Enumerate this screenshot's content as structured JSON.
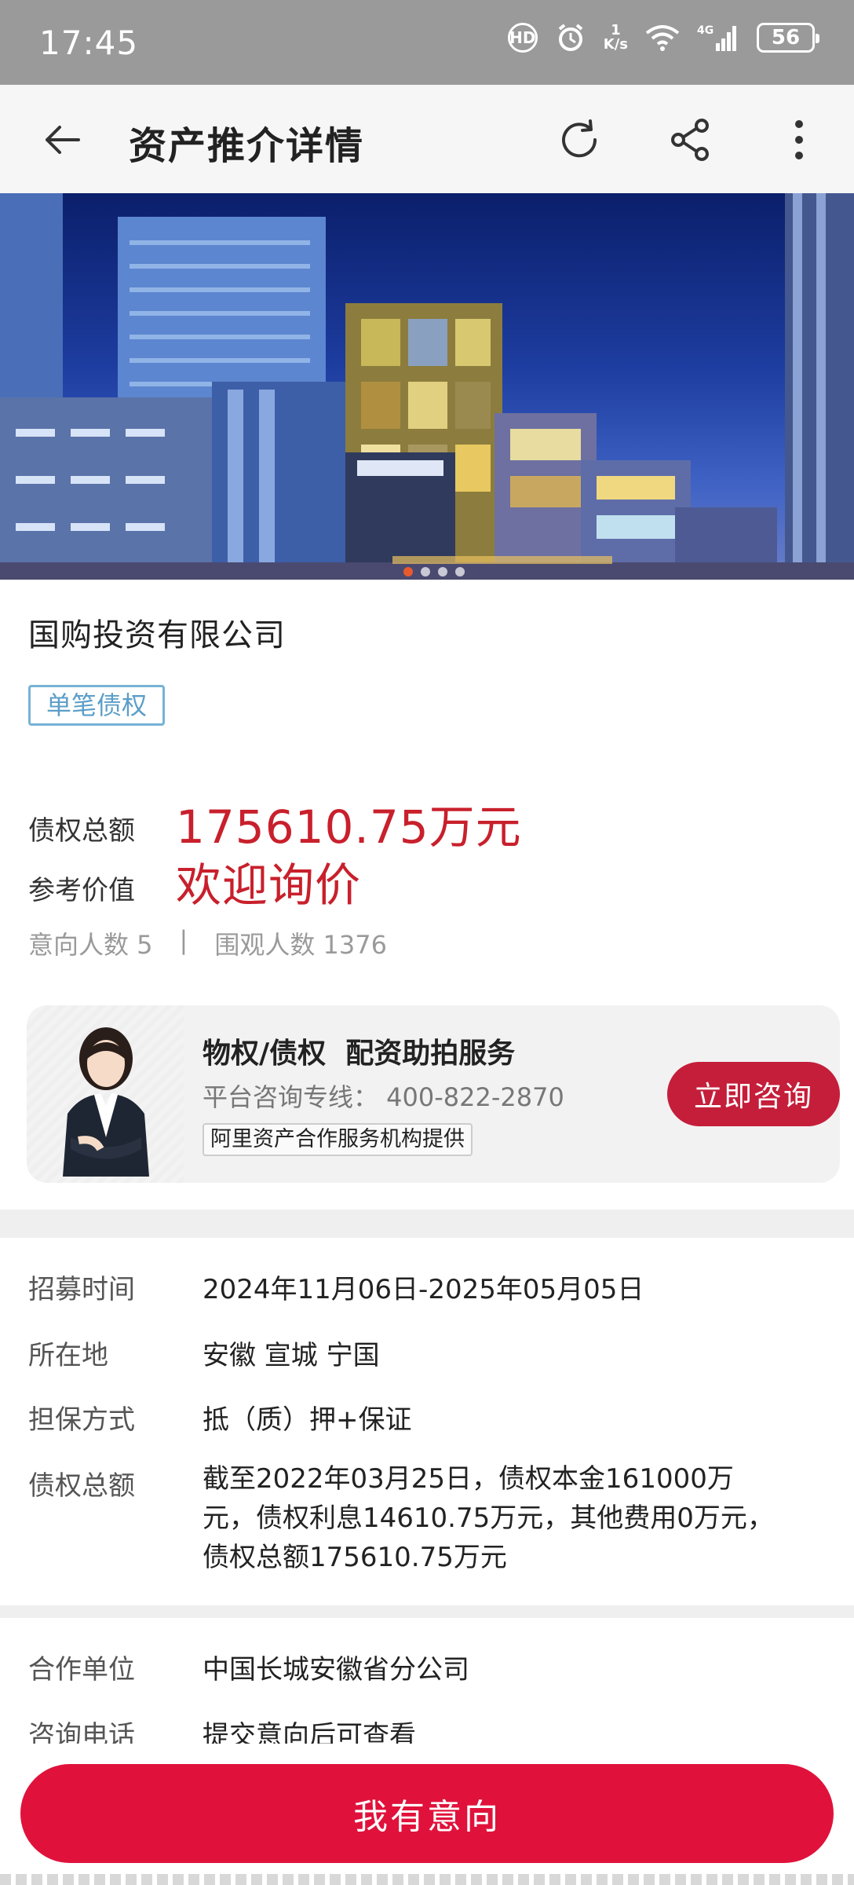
{
  "status_bar": {
    "time": "17:45",
    "hd_label": "HD",
    "speed_value": "1",
    "speed_unit": "K/s",
    "network": "4G",
    "battery": "56",
    "icons": [
      "hd-icon",
      "alarm-icon",
      "wifi-icon",
      "signal-icon",
      "battery-icon"
    ]
  },
  "app_bar": {
    "title": "资产推介详情",
    "icons": [
      "back-arrow-icon",
      "refresh-icon",
      "share-icon",
      "more-vertical-icon"
    ]
  },
  "banner": {
    "slide_count": 4,
    "active_slide": 1
  },
  "asset": {
    "company": "国购投资有限公司",
    "tag": "单笔债权",
    "total_label": "债权总额",
    "total_value": "175610.75万元",
    "ref_label": "参考价值",
    "ref_value": "欢迎询价",
    "intent_count_text": "意向人数 5",
    "separator": "|",
    "view_count_text": "围观人数 1376"
  },
  "consult": {
    "title": "物权/债权  配资助拍服务",
    "phone_text": "平台咨询专线： 400-822-2870",
    "note": "阿里资产合作服务机构提供",
    "button_label": "立即咨询"
  },
  "details": [
    {
      "label": "招募时间",
      "value": "2024年11月06日-2025年05月05日"
    },
    {
      "label": "所在地",
      "value": "安徽 宣城 宁国"
    },
    {
      "label": "担保方式",
      "value": "抵（质）押+保证"
    },
    {
      "label": "债权总额",
      "value": "截至2022年03月25日，债权本金161000万元，债权利息14610.75万元，其他费用0万元，债权总额175610.75万元"
    }
  ],
  "details2": [
    {
      "label": "合作单位",
      "value": "中国长城安徽省分公司"
    },
    {
      "label": "咨询电话",
      "value": "提交意向后可查看"
    }
  ],
  "bottom": {
    "intent_button": "我有意向"
  },
  "colors": {
    "accent_red": "#c8202c",
    "button_red": "#e0123b",
    "tag_blue": "#5c9ec8"
  }
}
